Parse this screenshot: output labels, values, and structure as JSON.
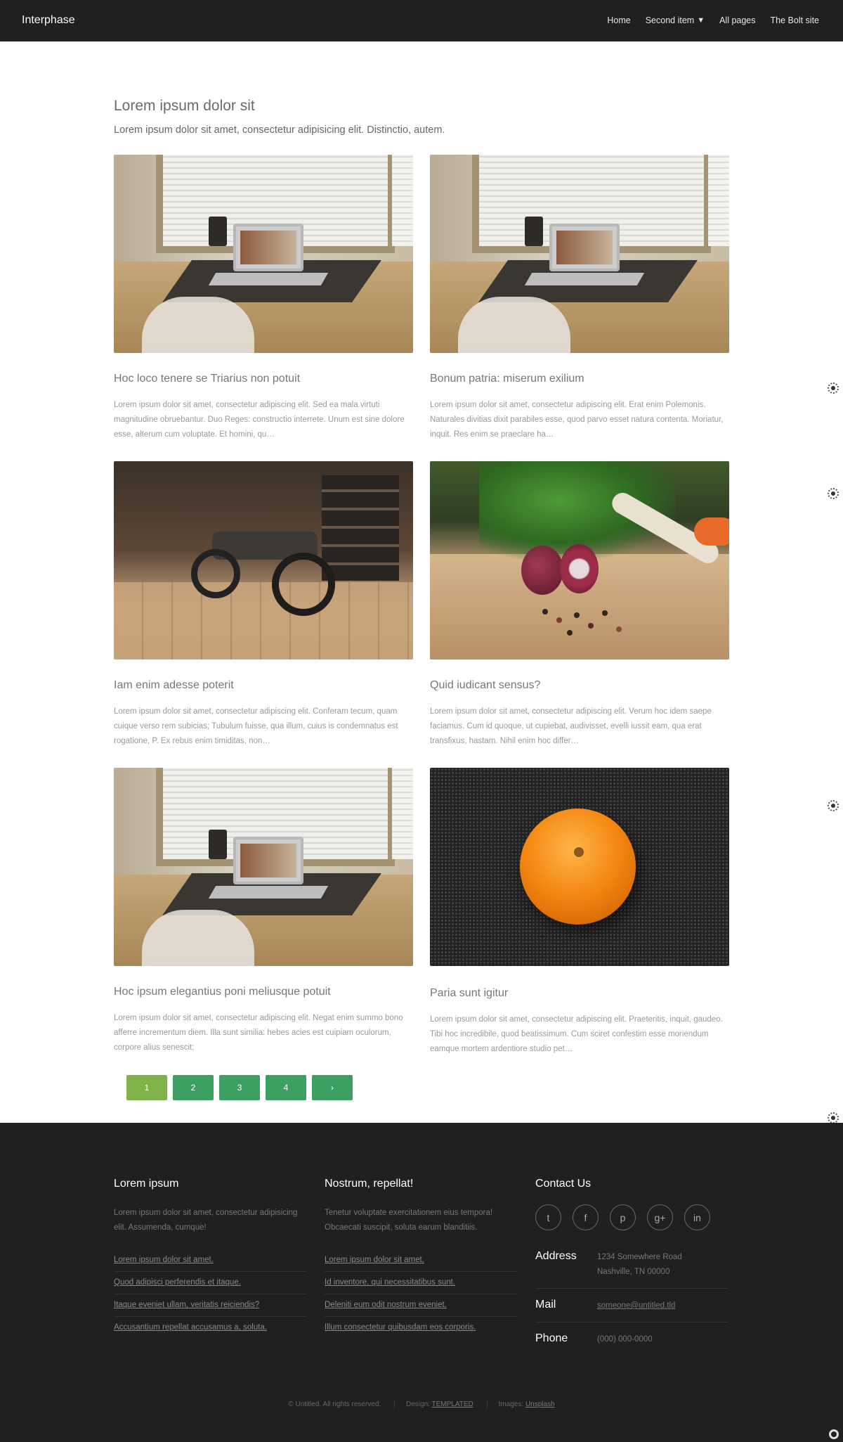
{
  "header": {
    "brand": "Interphase",
    "nav": [
      {
        "label": "Home"
      },
      {
        "label": "Second item",
        "caret": "▼"
      },
      {
        "label": "All pages"
      },
      {
        "label": "The Bolt site"
      }
    ]
  },
  "intro": {
    "title": "Lorem ipsum dolor sit",
    "subtitle": "Lorem ipsum dolor sit amet, consectetur adipisicing elit. Distinctio, autem."
  },
  "cards": [
    {
      "image": "desk-laptop-photo",
      "title": "Hoc loco tenere se Triarius non potuit",
      "text": "Lorem ipsum dolor sit amet, consectetur adipiscing elit. Sed ea mala virtuti magnitudine obruebantur. Duo Reges: constructio interrete. Unum est sine dolore esse, alterum cum voluptate. Et homini, qu…"
    },
    {
      "image": "desk-laptop-photo",
      "title": "Bonum patria: miserum exilium",
      "text": "Lorem ipsum dolor sit amet, consectetur adipiscing elit. Erat enim Polemonis. Naturales divitias dixit parabiles esse, quod parvo esset natura contenta. Moriatur, inquit. Res enim se praeclare ha…"
    },
    {
      "image": "motorcycle-garage-photo",
      "title": "Iam enim adesse poterit",
      "text": "Lorem ipsum dolor sit amet, consectetur adipiscing elit. Conferam tecum, quam cuique verso rem subicias; Tubulum fuisse, qua illum, cuius is condemnatus est rogatione, P. Ex rebus enim timiditas, non…"
    },
    {
      "image": "vegetables-photo",
      "title": "Quid iudicant sensus?",
      "text": "Lorem ipsum dolor sit amet, consectetur adipiscing elit. Verum hoc idem saepe faciamus. Cum id quoque, ut cupiebat, audivisset, evelli iussit eam, qua erat transfixus, hastam. Nihil enim hoc differ…"
    },
    {
      "image": "desk-laptop-photo",
      "title": "Hoc ipsum elegantius poni meliusque potuit",
      "text": "Lorem ipsum dolor sit amet, consectetur adipiscing elit. Negat enim summo bono afferre incrementum diem. Illa sunt similia: hebes acies est cuipiam oculorum, corpore alius senescit;"
    },
    {
      "image": "orange-photo",
      "title": "Paria sunt igitur",
      "text": "Lorem ipsum dolor sit amet, consectetur adipiscing elit. Praeteritis, inquit, gaudeo. Tibi hoc incredibile, quod beatissimum. Cum sciret confestim esse moriendum eamque mortem ardentiore studio pet…"
    }
  ],
  "pagination": {
    "pages": [
      "1",
      "2",
      "3",
      "4"
    ],
    "next": "›",
    "current": "1"
  },
  "footer": {
    "col1": {
      "title": "Lorem ipsum",
      "text": "Lorem ipsum dolor sit amet, consectetur adipisicing elit. Assumenda, cumque!",
      "links": [
        "Lorem ipsum dolor sit amet.",
        "Quod adipisci perferendis et itaque.",
        "Itaque eveniet ullam, veritatis reiciendis?",
        "Accusantium repellat accusamus a, soluta."
      ]
    },
    "col2": {
      "title": "Nostrum, repellat!",
      "text": "Tenetur voluptate exercitationem eius tempora! Obcaecati suscipit, soluta earum blanditiis.",
      "links": [
        "Lorem ipsum dolor sit amet.",
        "Id inventore, qui necessitatibus sunt.",
        "Deleniti eum odit nostrum eveniet.",
        "Illum consectetur quibusdam eos corporis."
      ]
    },
    "contact": {
      "title": "Contact Us",
      "socials": [
        {
          "icon": "twitter-icon",
          "glyph": "t"
        },
        {
          "icon": "facebook-icon",
          "glyph": "f"
        },
        {
          "icon": "pinterest-icon",
          "glyph": "p"
        },
        {
          "icon": "google-plus-icon",
          "glyph": "g+"
        },
        {
          "icon": "linkedin-icon",
          "glyph": "in"
        }
      ],
      "address_label": "Address",
      "address_value": "1234 Somewhere Road\nNashville, TN 00000",
      "mail_label": "Mail",
      "mail_value": "someone@untitled.tld",
      "phone_label": "Phone",
      "phone_value": "(000) 000-0000"
    },
    "copyright": "© Untitled. All rights reserved.",
    "design_label": "Design:",
    "design_link": "TEMPLATED",
    "images_label": "Images:",
    "images_link": "Unsplash"
  },
  "colors": {
    "header_bg": "#1f2020",
    "button_green": "#3ca063",
    "button_active": "#80b24a"
  }
}
